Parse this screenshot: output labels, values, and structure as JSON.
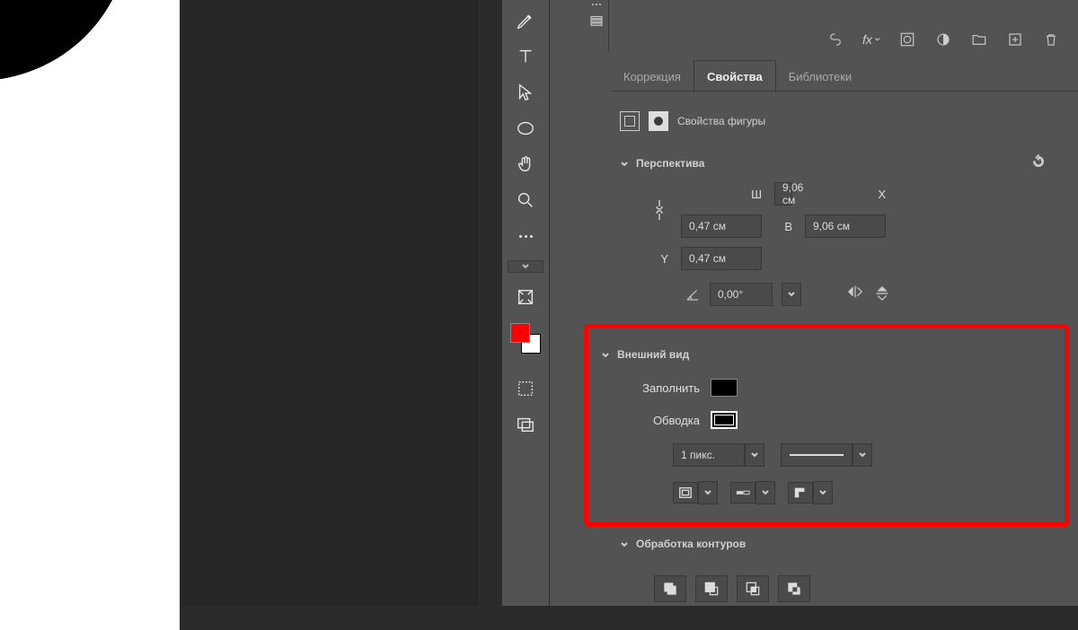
{
  "tabs": {
    "correction": "Коррекция",
    "properties": "Свойства",
    "libraries": "Библиотеки"
  },
  "panel": {
    "title": "Свойства фигуры"
  },
  "sections": {
    "perspective": "Перспектива",
    "appearance": "Внешний вид",
    "pathops": "Обработка контуров"
  },
  "dimensions": {
    "w_label": "Ш",
    "w_value": "9,06 см",
    "h_label": "В",
    "h_value": "9,06 см",
    "x_label": "X",
    "x_value": "0,47 см",
    "y_label": "Y",
    "y_value": "0,47 см",
    "angle": "0,00°"
  },
  "appearance": {
    "fill_label": "Заполнить",
    "stroke_label": "Обводка",
    "stroke_width": "1 пикс.",
    "fill_color": "#000000"
  },
  "colors": {
    "foreground": "#ff0000",
    "background": "#ffffff",
    "highlight": "#ff0000"
  }
}
